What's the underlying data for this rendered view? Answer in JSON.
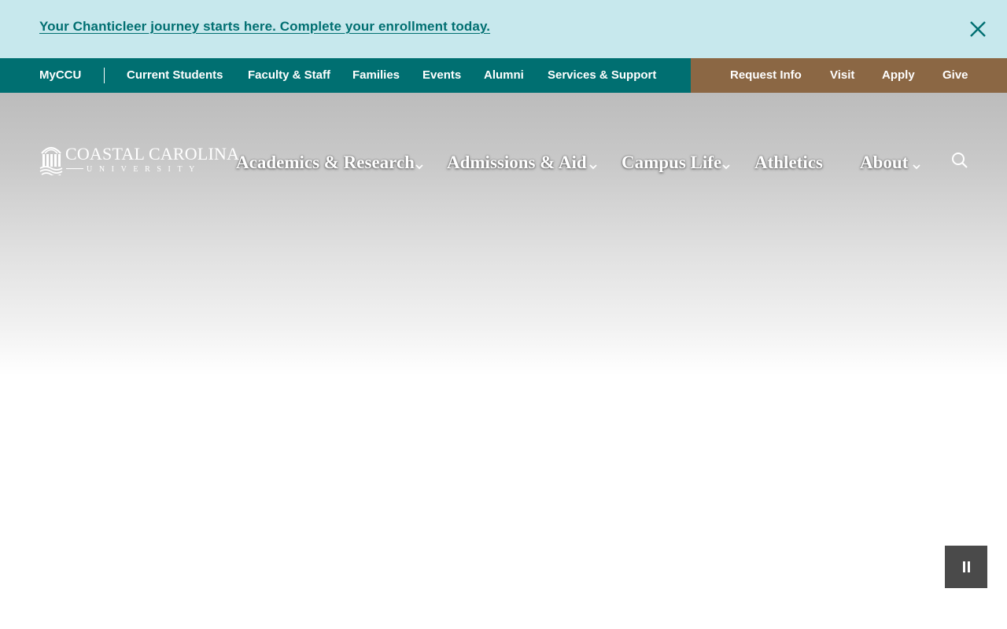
{
  "alert": {
    "text": "Your Chanticleer journey starts here. Complete your enrollment today."
  },
  "utility_nav": {
    "left": [
      {
        "label": "MyCCU"
      },
      {
        "label": "Current Students"
      },
      {
        "label": "Faculty & Staff"
      },
      {
        "label": "Families"
      },
      {
        "label": "Events"
      },
      {
        "label": "Alumni"
      },
      {
        "label": "Services & Support"
      }
    ],
    "right": [
      {
        "label": "Request Info"
      },
      {
        "label": "Visit"
      },
      {
        "label": "Apply"
      },
      {
        "label": "Give"
      }
    ]
  },
  "logo": {
    "main": "COASTAL CAROLINA",
    "sub": "UNIVERSITY"
  },
  "main_nav": [
    {
      "label": "Academics & Research",
      "has_dropdown": true
    },
    {
      "label": "Admissions & Aid",
      "has_dropdown": true
    },
    {
      "label": "Campus Life",
      "has_dropdown": true
    },
    {
      "label": "Athletics",
      "has_dropdown": false
    },
    {
      "label": "About",
      "has_dropdown": true
    }
  ],
  "icons": {
    "close": "close-icon",
    "search": "search-icon",
    "pause": "pause-icon",
    "chevron": "chevron-down-icon"
  },
  "colors": {
    "alert_bg": "#c7e8ed",
    "teal": "#006f71",
    "bronze": "#8b6744",
    "pause_bg": "#4a4a4a"
  }
}
